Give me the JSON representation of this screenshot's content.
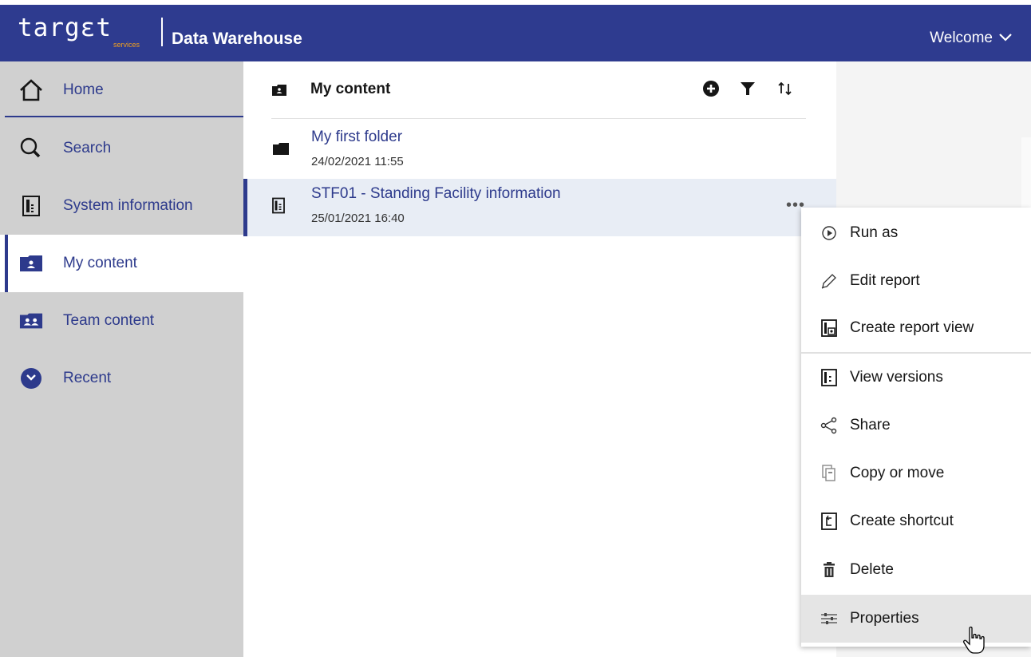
{
  "header": {
    "logo_text": "targεt",
    "logo_sub": "services",
    "app_title": "Data Warehouse",
    "welcome": "Welcome"
  },
  "sidebar": {
    "items": [
      {
        "label": "Home",
        "icon": "home-icon"
      },
      {
        "label": "Search",
        "icon": "search-icon"
      },
      {
        "label": "System information",
        "icon": "system-information-icon"
      },
      {
        "label": "My content",
        "icon": "my-content-folder-icon",
        "selected": true
      },
      {
        "label": "Team content",
        "icon": "team-content-folder-icon"
      },
      {
        "label": "Recent",
        "icon": "recent-clock-icon"
      }
    ]
  },
  "content": {
    "title": "My content",
    "tools": [
      "add-icon",
      "filter-icon",
      "sort-icon"
    ],
    "rows": [
      {
        "name": "My first folder",
        "date": "24/02/2021 11:55",
        "icon": "folder-icon"
      },
      {
        "name": "STF01 - Standing Facility information",
        "date": "25/01/2021 16:40",
        "icon": "report-icon",
        "selected": true
      }
    ]
  },
  "context_menu": {
    "items": [
      {
        "label": "Run as",
        "icon": "run-icon"
      },
      {
        "label": "Edit report",
        "icon": "pencil-icon"
      },
      {
        "label": "Create report view",
        "icon": "report-view-icon"
      },
      {
        "label": "View versions",
        "icon": "versions-icon"
      },
      {
        "label": "Share",
        "icon": "share-icon"
      },
      {
        "label": "Copy or move",
        "icon": "copy-icon"
      },
      {
        "label": "Create shortcut",
        "icon": "shortcut-icon"
      },
      {
        "label": "Delete",
        "icon": "trash-icon"
      },
      {
        "label": "Properties",
        "icon": "properties-icon",
        "hovered": true
      }
    ]
  },
  "colors": {
    "header_bg": "#2e3b8f",
    "accent": "#2d3a8c",
    "sidebar_bg": "#d0d0d0",
    "logo_sub": "#f0a020"
  }
}
